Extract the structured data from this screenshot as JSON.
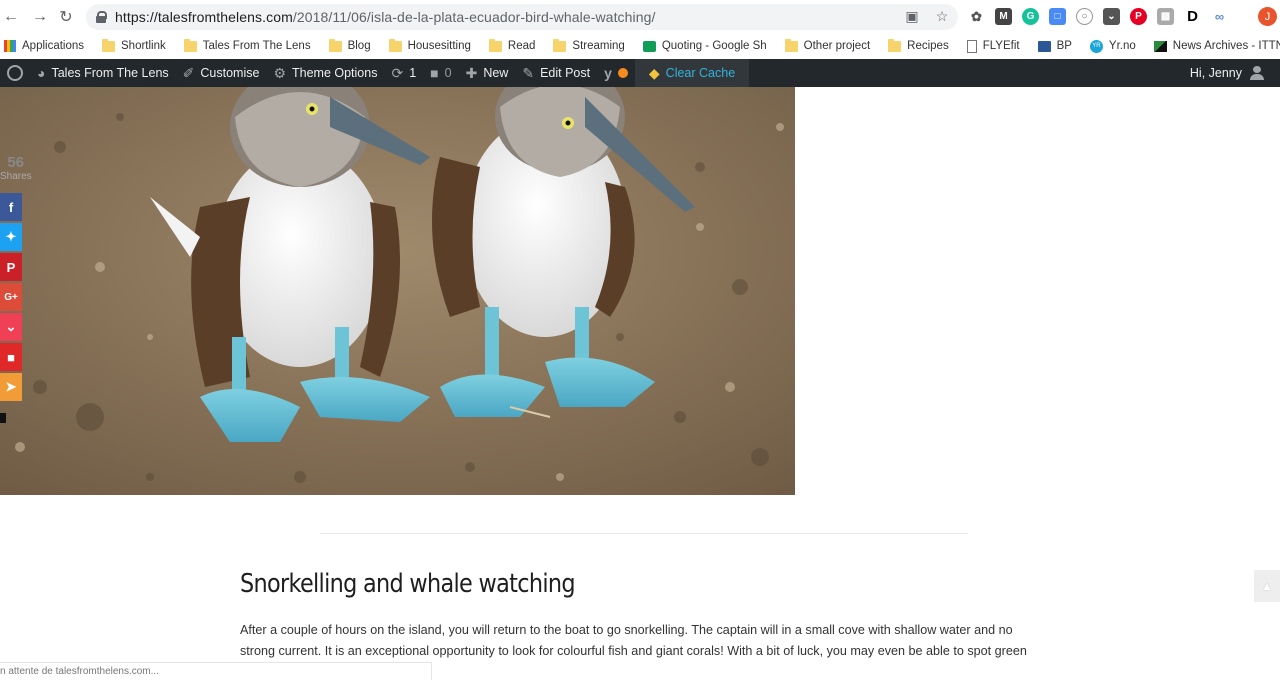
{
  "browser": {
    "url_host": "https://talesfromthelens.com",
    "url_path": "/2018/11/06/isla-de-la-plata-ecuador-bird-whale-watching/",
    "profile_initial": "J",
    "status_text": "n attente de talesfromthelens.com..."
  },
  "bookmarks": [
    {
      "label": "Applications",
      "icon": "apps-grid-icon"
    },
    {
      "label": "Shortlink",
      "icon": "folder-icon"
    },
    {
      "label": "Tales From The Lens",
      "icon": "folder-icon"
    },
    {
      "label": "Blog",
      "icon": "folder-icon"
    },
    {
      "label": "Housesitting",
      "icon": "folder-icon"
    },
    {
      "label": "Read",
      "icon": "folder-icon"
    },
    {
      "label": "Streaming",
      "icon": "folder-icon"
    },
    {
      "label": "Quoting - Google Sh",
      "icon": "google-sheets-icon"
    },
    {
      "label": "Other project",
      "icon": "folder-icon"
    },
    {
      "label": "Recipes",
      "icon": "folder-icon"
    },
    {
      "label": "FLYEfit",
      "icon": "page-icon"
    },
    {
      "label": "BP",
      "icon": "bp-icon"
    },
    {
      "label": "Yr.no",
      "icon": "yr-icon"
    },
    {
      "label": "News Archives - ITTN",
      "icon": "ittn-icon"
    }
  ],
  "admin_bar": {
    "site_name": "Tales From The Lens",
    "customise": "Customise",
    "theme_options": "Theme Options",
    "updates_count": "1",
    "comments_count": "0",
    "new_label": "New",
    "edit_post": "Edit Post",
    "clear_cache": "Clear Cache",
    "greeting": "Hi, Jenny"
  },
  "share": {
    "count": "56",
    "label": "Shares",
    "networks": [
      "facebook",
      "twitter",
      "pinterest",
      "google-plus",
      "pocket",
      "flipboard",
      "share"
    ]
  },
  "article": {
    "section_title": "Snorkelling and whale watching",
    "paragraph": "After a couple of hours on the island, you will return to the boat to go snorkelling. The captain will in a small cove with shallow water and no strong current. It is an exceptional opportunity to look for colourful fish and giant corals! With a bit of luck, you may even be able to spot green turtles and manta rays."
  }
}
